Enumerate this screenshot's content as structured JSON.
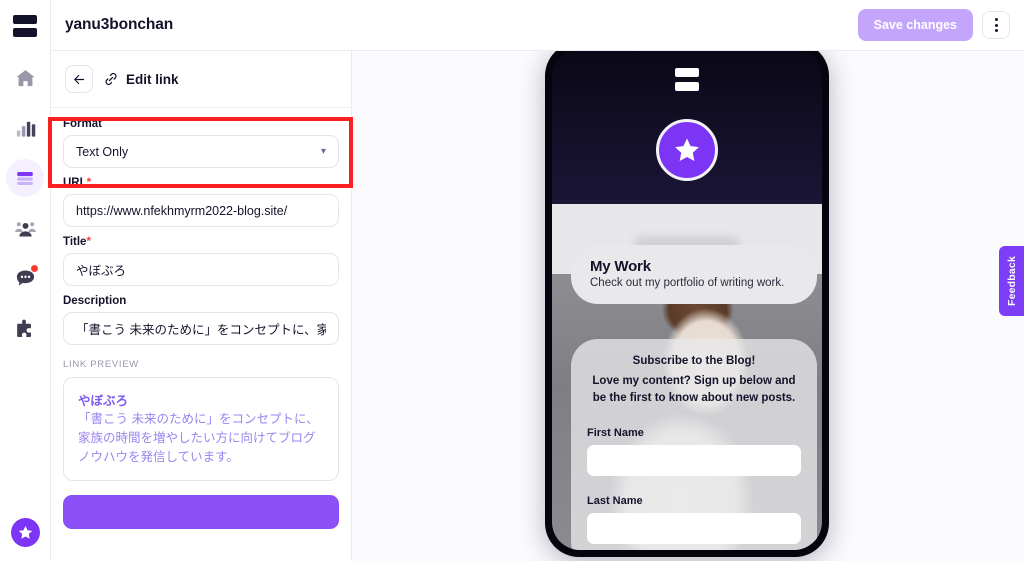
{
  "app": {
    "accent_purple": "#7c35f5",
    "accent_purple_light": "#c3a6fb",
    "annotation_color": "#fb2020"
  },
  "sidebar": {
    "logo_name": "bio-link-logo",
    "items": [
      {
        "label": "Home",
        "icon": "home-icon",
        "active": false
      },
      {
        "label": "Analytics",
        "icon": "bar-chart-icon",
        "active": false
      },
      {
        "label": "Links",
        "icon": "stacked-links-icon",
        "active": true
      },
      {
        "label": "Audience",
        "icon": "people-icon",
        "active": false
      },
      {
        "label": "Messages",
        "icon": "chat-bubble-icon",
        "active": false,
        "badge": true
      },
      {
        "label": "Integrations",
        "icon": "puzzle-piece-icon",
        "active": false
      }
    ],
    "avatar_icon": "star-avatar-icon"
  },
  "header": {
    "title": "yanu3bonchan",
    "save_label": "Save changes",
    "save_disabled": true,
    "kebab_icon": "more-vertical-icon"
  },
  "panel": {
    "back_icon": "arrow-left-icon",
    "link_icon": "chain-link-icon",
    "heading": "Edit link",
    "fields": {
      "format": {
        "label": "Format",
        "value": "Text Only",
        "chevron": "chevron-down-icon",
        "options": [
          "Text Only"
        ]
      },
      "url": {
        "label": "URL",
        "required": "*",
        "value": "https://www.nfekhmyrm2022-blog.site/",
        "placeholder": "https://"
      },
      "title": {
        "label": "Title",
        "required": "*",
        "value": "やぼぶろ",
        "placeholder": "Title"
      },
      "description": {
        "label": "Description",
        "value": "「書こう 未来のために」をコンセプトに、家族の",
        "placeholder": "Description"
      }
    },
    "link_preview": {
      "section_label": "LINK PREVIEW",
      "title": "やぼぶろ",
      "description": "「書こう 未来のために」をコンセプトに、家族の時間を増やしたい方に向けてブログノウハウを発信しています。"
    },
    "cta_label": ""
  },
  "preview": {
    "device": "mobile-phone-frame",
    "logo_icon": "bio-link-logo",
    "avatar_icon": "star-avatar-icon",
    "cards": {
      "work": {
        "title": "My Work",
        "subtitle": "Check out my portfolio of writing work."
      },
      "subscribe": {
        "heading": "Subscribe to the Blog!",
        "body": "Love my content? Sign up below and be the first to know about new posts.",
        "first_name_label": "First Name",
        "first_name_value": "",
        "last_name_label": "Last Name",
        "last_name_value": ""
      }
    }
  },
  "feedback": {
    "label": "Feedback"
  }
}
